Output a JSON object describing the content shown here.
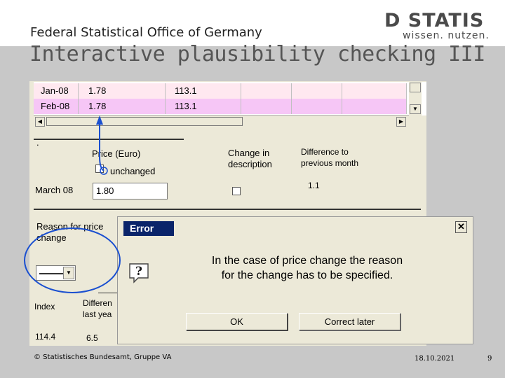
{
  "header": {
    "org_name": "Federal Statistical Office of Germany",
    "logo_word": "D STATIS",
    "logo_sub": "wissen. nutzen.",
    "slide_title": "Interactive plausibility checking III"
  },
  "grid": {
    "rows": [
      {
        "month": "Jan-08",
        "price": "1.78",
        "index": "113.1"
      },
      {
        "month": "Feb-08",
        "price": "1.78",
        "index": "113.1"
      }
    ]
  },
  "form": {
    "dot": ".",
    "price_header": "Price (Euro)",
    "unchanged_label": "unchanged",
    "change_desc_header": "Change in description",
    "diff_prev_header": "Difference to previous month",
    "month_label": "March 08",
    "price_value": "1.80",
    "diff_prev_value": "1.1",
    "reason_label": "Reason for price change",
    "index_label": "Index",
    "diff_last_year_label": "Differen last yea",
    "index_value": "114.4",
    "diff_last_year_value": "6.5"
  },
  "dialog": {
    "title": "Error",
    "close_glyph": "✕",
    "icon_glyph": "?",
    "message": "In the case of price change the reason for the change has to be specified.",
    "ok_label": "OK",
    "later_label": "Correct later"
  },
  "footer": {
    "copyright": "© Statistisches Bundesamt, Gruppe VA",
    "date": "18.10.2021",
    "page": "9"
  },
  "colors": {
    "highlight_row_1": "#ffe8f0",
    "highlight_row_2": "#f6c6f6",
    "dialog_title_bg": "#0a246a",
    "annotation_blue": "#1a4fd0"
  }
}
